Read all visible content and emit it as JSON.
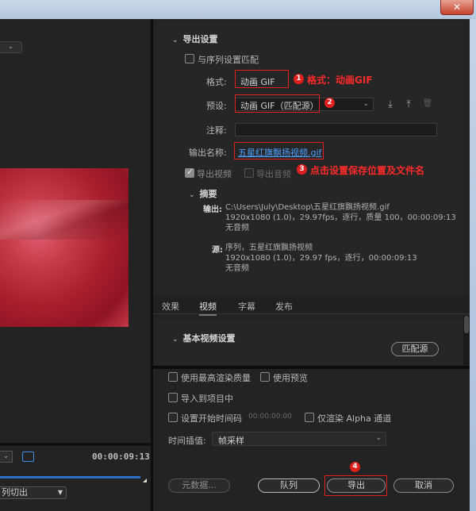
{
  "window": {
    "close_glyph": "✕"
  },
  "left": {
    "timecode": "00:00:09:13",
    "sequence_dd": "列切出",
    "dd_glyph": "⌄"
  },
  "export_settings": {
    "title": "导出设置",
    "match_sequence_label": "与序列设置匹配",
    "format_label": "格式:",
    "format_value": "动画 GIF",
    "preset_label": "预设:",
    "preset_value": "动画 GIF（匹配源）",
    "comments_label": "注释:",
    "comments_value": "",
    "output_name_label": "输出名称:",
    "output_name_value": "五星红旗飘扬视频.gif",
    "export_video_label": "导出视频",
    "export_audio_label": "导出音频"
  },
  "annotations": {
    "a1": {
      "num": "1",
      "text": "格式：动画GIF"
    },
    "a2": {
      "num": "2"
    },
    "a3": {
      "num": "3",
      "text": "点击设置保存位置及文件名"
    },
    "a4": {
      "num": "4"
    },
    "color": "#e01f1f"
  },
  "summary": {
    "title": "摘要",
    "output_key": "输出:",
    "output_lines": [
      "C:\\Users\\July\\Desktop\\五星红旗飘扬视频.gif",
      "1920x1080 (1.0)，29.97fps，逐行，质量 100，00:00:09:13",
      "无音频"
    ],
    "source_key": "源:",
    "source_lines": [
      "序列，五星红旗飘扬视频",
      "1920x1080 (1.0)，29.97 fps，逐行，00:00:09:13",
      "无音频"
    ]
  },
  "tabs": [
    "效果",
    "视频",
    "字幕",
    "发布"
  ],
  "video": {
    "basic_title": "基本视频设置",
    "match_source_btn": "匹配源"
  },
  "bottom": {
    "max_quality_label": "使用最高渲染质量",
    "use_previews_label": "使用预览",
    "import_project_label": "导入到项目中",
    "set_start_tc_label": "设置开始时间码",
    "start_tc_value": "00:00:00:00",
    "alpha_only_label": "仅渲染 Alpha 通道",
    "interp_label": "时间插值:",
    "interp_value": "帧采样",
    "metadata_btn": "元数据...",
    "queue_btn": "队列",
    "export_btn": "导出",
    "cancel_btn": "取消"
  },
  "icons": {
    "save_preset": "⤓",
    "import_preset": "⤒",
    "delete_preset": "🗑"
  }
}
